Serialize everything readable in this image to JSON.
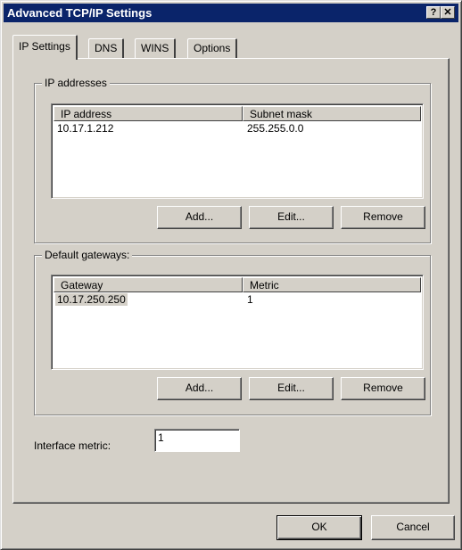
{
  "window": {
    "title": "Advanced TCP/IP Settings",
    "help_label": "?",
    "close_label": "✕"
  },
  "tabs": [
    {
      "label": "IP Settings",
      "active": true
    },
    {
      "label": "DNS"
    },
    {
      "label": "WINS"
    },
    {
      "label": "Options"
    }
  ],
  "ip_addresses": {
    "group_label": "IP addresses",
    "columns": [
      "IP address",
      "Subnet mask"
    ],
    "rows": [
      {
        "ip": "10.17.1.212",
        "mask": "255.255.0.0"
      }
    ],
    "buttons": {
      "add": "Add...",
      "edit": "Edit...",
      "remove": "Remove"
    }
  },
  "gateways": {
    "group_label": "Default gateways:",
    "columns": [
      "Gateway",
      "Metric"
    ],
    "rows": [
      {
        "gateway": "10.17.250.250",
        "metric": "1",
        "selected": true
      }
    ],
    "buttons": {
      "add": "Add...",
      "edit": "Edit...",
      "remove": "Remove"
    }
  },
  "interface_metric": {
    "label": "Interface metric:",
    "value": "1"
  },
  "footer": {
    "ok": "OK",
    "cancel": "Cancel"
  }
}
